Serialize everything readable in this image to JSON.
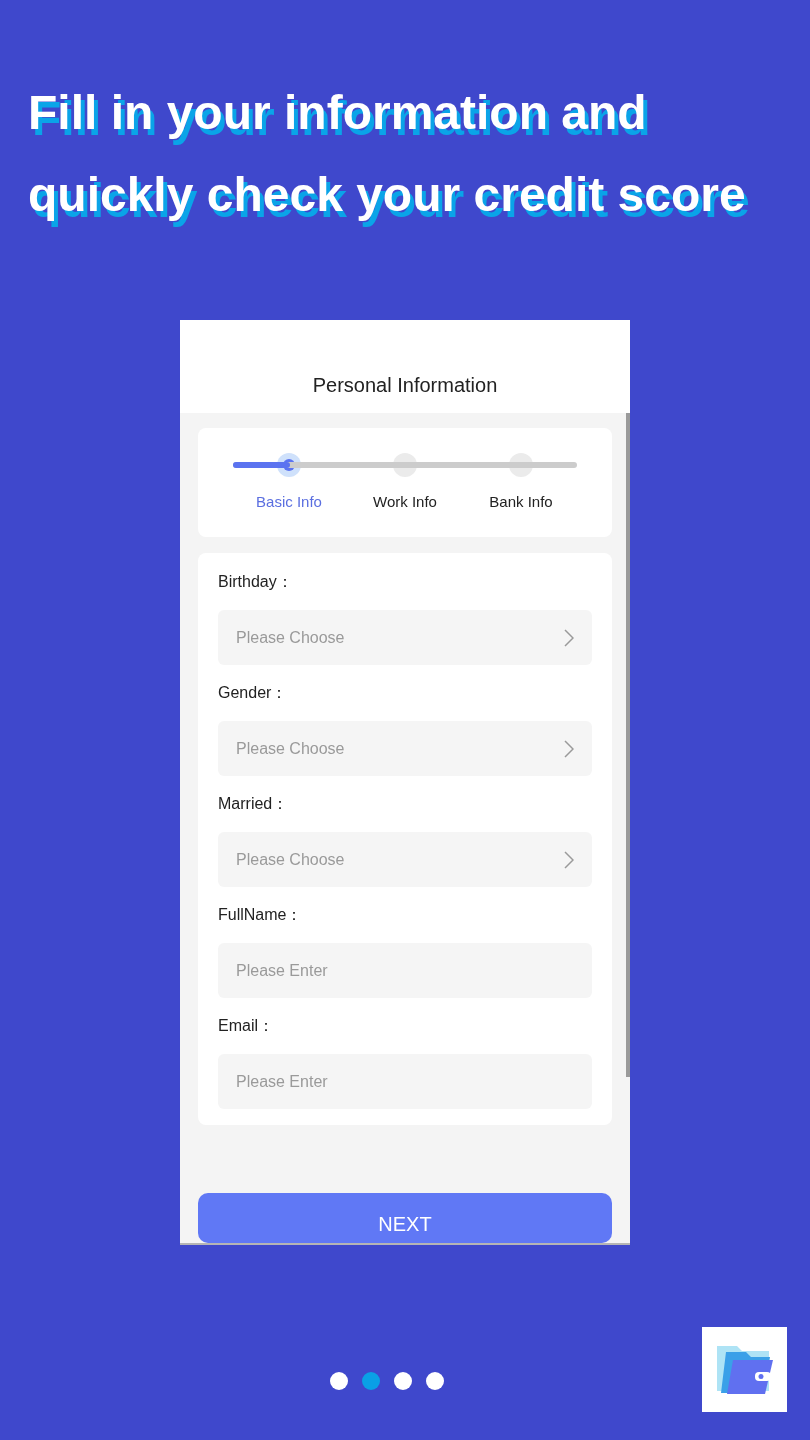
{
  "headline": "Fill in your information and quickly check your credit score",
  "screen": {
    "title": "Personal Information",
    "stepper": {
      "level": 0.165,
      "steps": [
        {
          "label": "Basic Info",
          "selected": true
        },
        {
          "label": "Work Info",
          "selected": false
        },
        {
          "label": "Bank Info",
          "selected": false
        }
      ]
    },
    "fields": [
      {
        "label": "Birthday：",
        "kind": "select",
        "placeholder": "Please Choose"
      },
      {
        "label": "Gender：",
        "kind": "select",
        "placeholder": "Please Choose"
      },
      {
        "label": "Married：",
        "kind": "select",
        "placeholder": "Please Choose"
      },
      {
        "label": "FullName：",
        "kind": "text",
        "placeholder": "Please Enter"
      },
      {
        "label": "Email：",
        "kind": "text",
        "placeholder": "Please Enter"
      }
    ],
    "next_button": "NEXT"
  },
  "pager": [
    {
      "selected": false
    },
    {
      "selected": true
    },
    {
      "selected": false
    },
    {
      "selected": false
    }
  ]
}
